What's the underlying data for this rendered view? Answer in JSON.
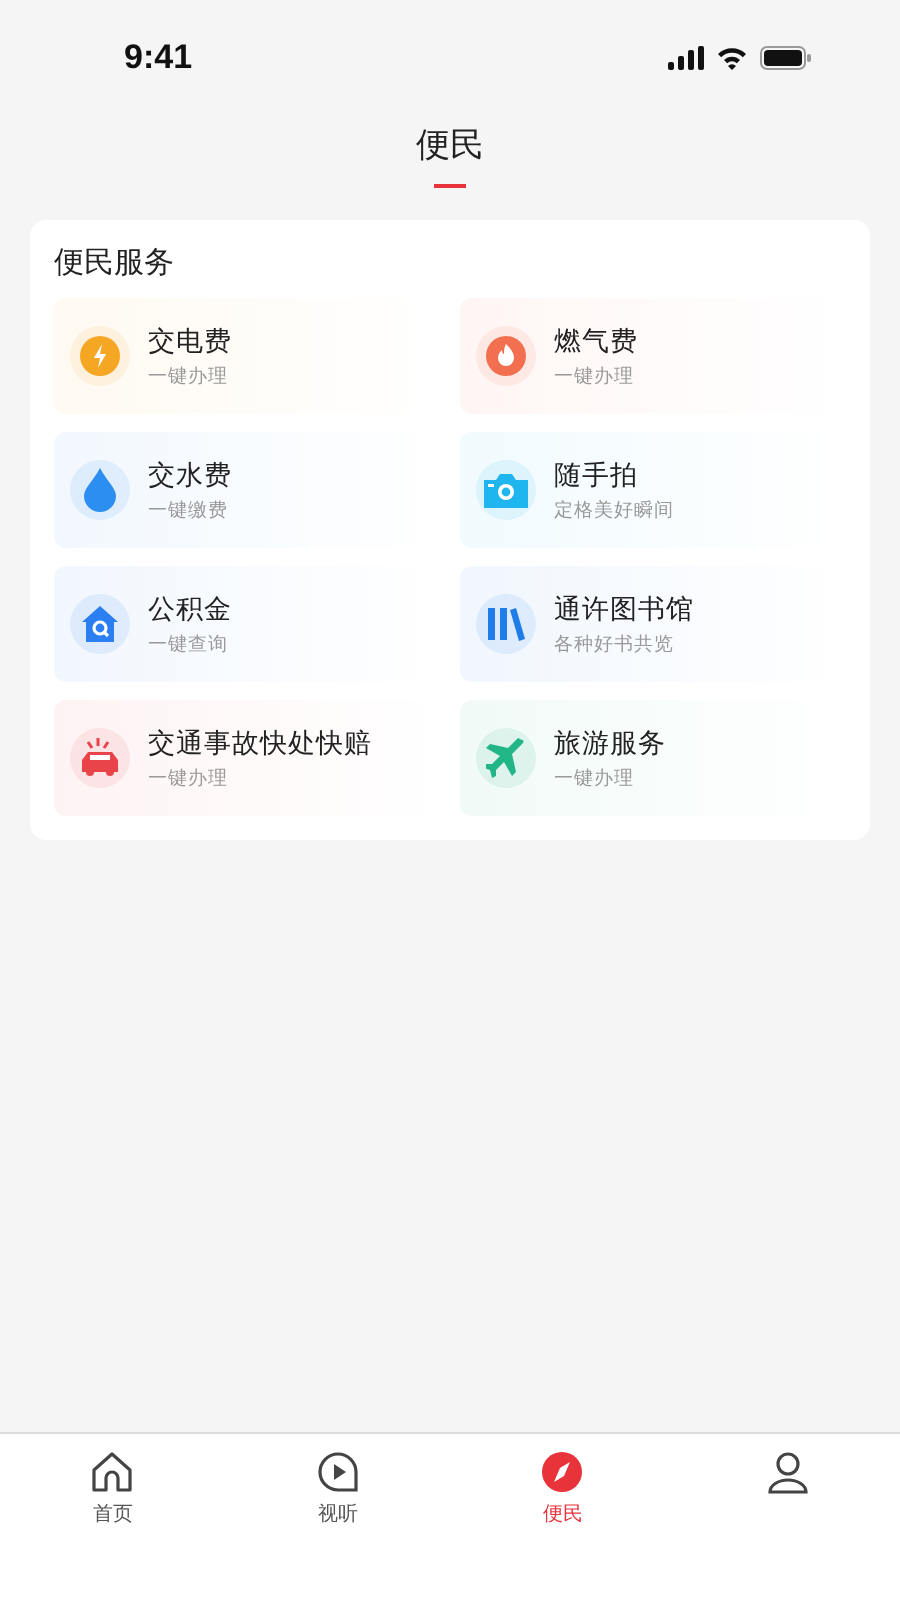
{
  "status_bar": {
    "time": "9:41"
  },
  "header": {
    "title": "便民"
  },
  "services": {
    "title": "便民服务",
    "items": [
      {
        "kind": "bolt",
        "name": "交电费",
        "desc": "一键办理",
        "color": "#f5a623"
      },
      {
        "kind": "flame",
        "name": "燃气费",
        "desc": "一键办理",
        "color": "#f2704f"
      },
      {
        "kind": "drop",
        "name": "交水费",
        "desc": "一键缴费",
        "color": "#2b8ef0"
      },
      {
        "kind": "camera",
        "name": "随手拍",
        "desc": "定格美好瞬间",
        "color": "#1fb6f0"
      },
      {
        "kind": "house",
        "name": "公积金",
        "desc": "一键查询",
        "color": "#2b7ff0"
      },
      {
        "kind": "books",
        "name": "通许图书馆",
        "desc": "各种好书共览",
        "color": "#1e7de8"
      },
      {
        "kind": "car",
        "name": "交通事故快处快赔",
        "desc": "一键办理",
        "color": "#e8444a"
      },
      {
        "kind": "plane",
        "name": "旅游服务",
        "desc": "一键办理",
        "color": "#22b585"
      }
    ]
  },
  "tab_bar": [
    {
      "kind": "home",
      "label": "首页",
      "selected": false
    },
    {
      "kind": "play",
      "label": "视听",
      "selected": false
    },
    {
      "kind": "compass",
      "label": "便民",
      "selected": true
    },
    {
      "kind": "person",
      "selected": false
    }
  ]
}
